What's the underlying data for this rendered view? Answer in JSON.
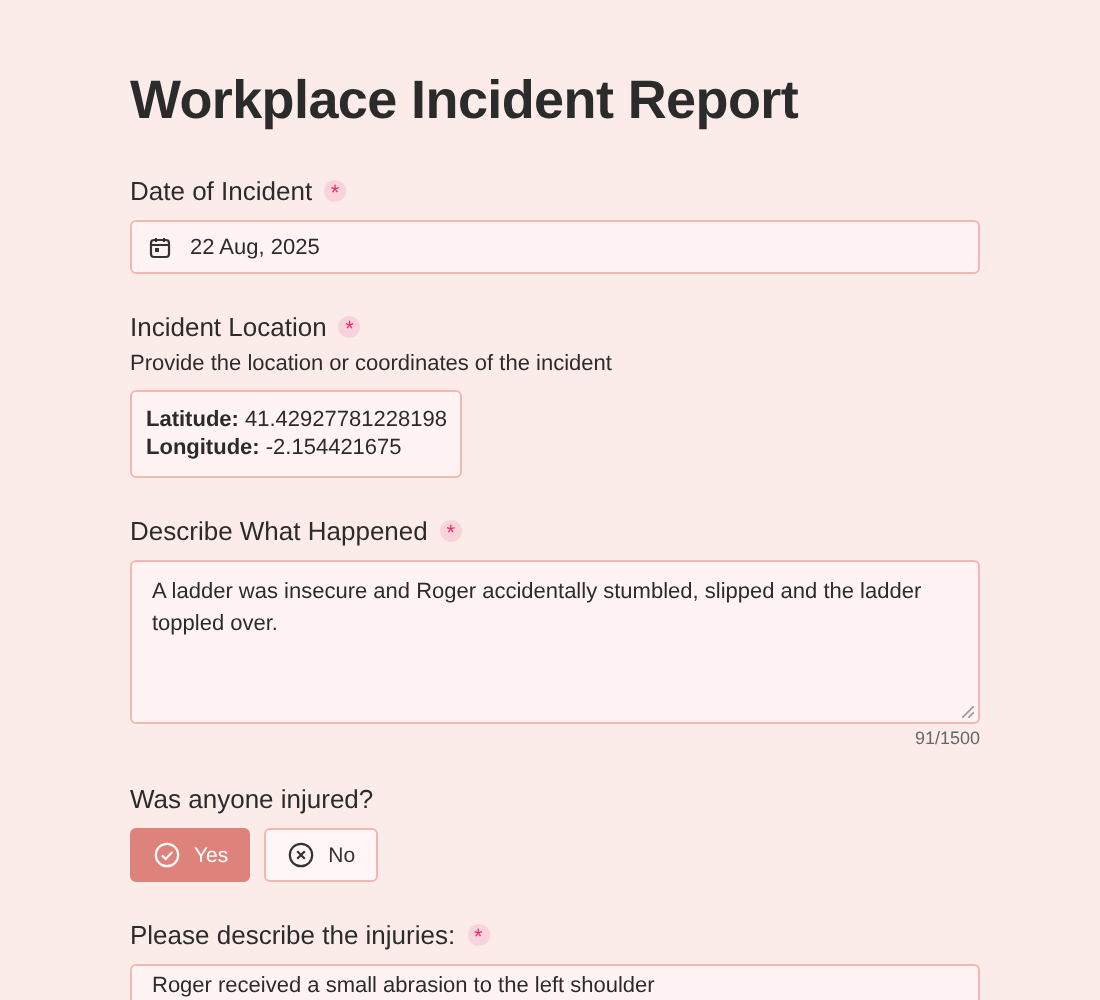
{
  "title": "Workplace Incident Report",
  "date_field": {
    "label": "Date of Incident",
    "required_mark": "*",
    "value": "22 Aug, 2025"
  },
  "location_field": {
    "label": "Incident Location",
    "required_mark": "*",
    "description": "Provide the location or coordinates of the incident",
    "value": "**Latitude:** 41.42927781228198\n**Longitude:** -2.154421675"
  },
  "description_field": {
    "label": "Describe What Happened",
    "required_mark": "*",
    "value": "A ladder was insecure and Roger accidentally stumbled, slipped and the ladder toppled over.",
    "counter": "91/1500"
  },
  "injured_question": {
    "label": "Was anyone injured?",
    "options": [
      {
        "label": "Yes",
        "kind": "yes",
        "selected": true
      },
      {
        "label": "No",
        "kind": "no",
        "selected": false
      }
    ]
  },
  "injuries_field": {
    "label": "Please describe the injuries:",
    "required_mark": "*",
    "value": "Roger received a small abrasion to the left shoulder"
  }
}
